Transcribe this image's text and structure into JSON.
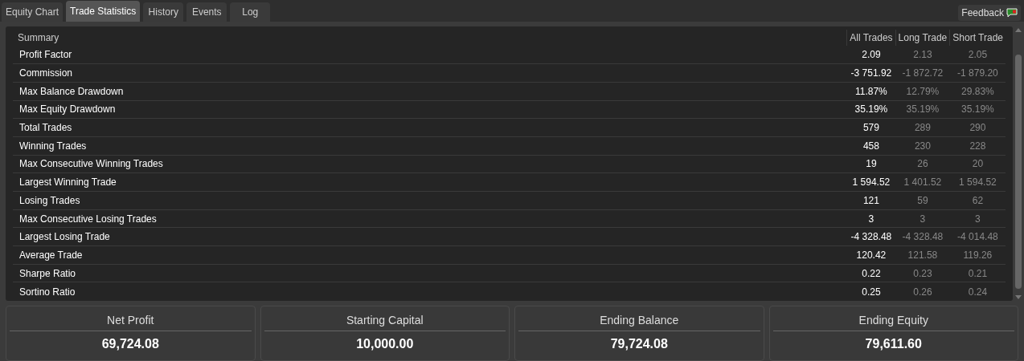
{
  "tabs": [
    {
      "label": "Equity Chart",
      "selected": false
    },
    {
      "label": "Trade Statistics",
      "selected": true
    },
    {
      "label": "History",
      "selected": false
    },
    {
      "label": "Events",
      "selected": false
    },
    {
      "label": "Log",
      "selected": false
    }
  ],
  "feedback": {
    "label": "Feedback"
  },
  "table": {
    "columns": [
      "Summary",
      "All Trades",
      "Long Trade",
      "Short Trade"
    ],
    "rows": [
      [
        "Profit Factor",
        "2.09",
        "2.13",
        "2.05"
      ],
      [
        "Commission",
        "-3 751.92",
        "-1 872.72",
        "-1 879.20"
      ],
      [
        "Max Balance Drawdown",
        "11.87%",
        "12.79%",
        "29.83%"
      ],
      [
        "Max Equity Drawdown",
        "35.19%",
        "35.19%",
        "35.19%"
      ],
      [
        "Total Trades",
        "579",
        "289",
        "290"
      ],
      [
        "Winning Trades",
        "458",
        "230",
        "228"
      ],
      [
        "Max Consecutive Winning Trades",
        "19",
        "26",
        "20"
      ],
      [
        "Largest Winning Trade",
        "1 594.52",
        "1 401.52",
        "1 594.52"
      ],
      [
        "Losing Trades",
        "121",
        "59",
        "62"
      ],
      [
        "Max Consecutive Losing Trades",
        "3",
        "3",
        "3"
      ],
      [
        "Largest Losing Trade",
        "-4 328.48",
        "-4 328.48",
        "-4 014.48"
      ],
      [
        "Average Trade",
        "120.42",
        "121.58",
        "119.26"
      ],
      [
        "Sharpe Ratio",
        "0.22",
        "0.23",
        "0.21"
      ],
      [
        "Sortino Ratio",
        "0.25",
        "0.26",
        "0.24"
      ]
    ]
  },
  "cards": [
    {
      "title": "Net Profit",
      "value": "69,724.08"
    },
    {
      "title": "Starting Capital",
      "value": "10,000.00"
    },
    {
      "title": "Ending Balance",
      "value": "79,724.08"
    },
    {
      "title": "Ending Equity",
      "value": "79,611.60"
    }
  ]
}
